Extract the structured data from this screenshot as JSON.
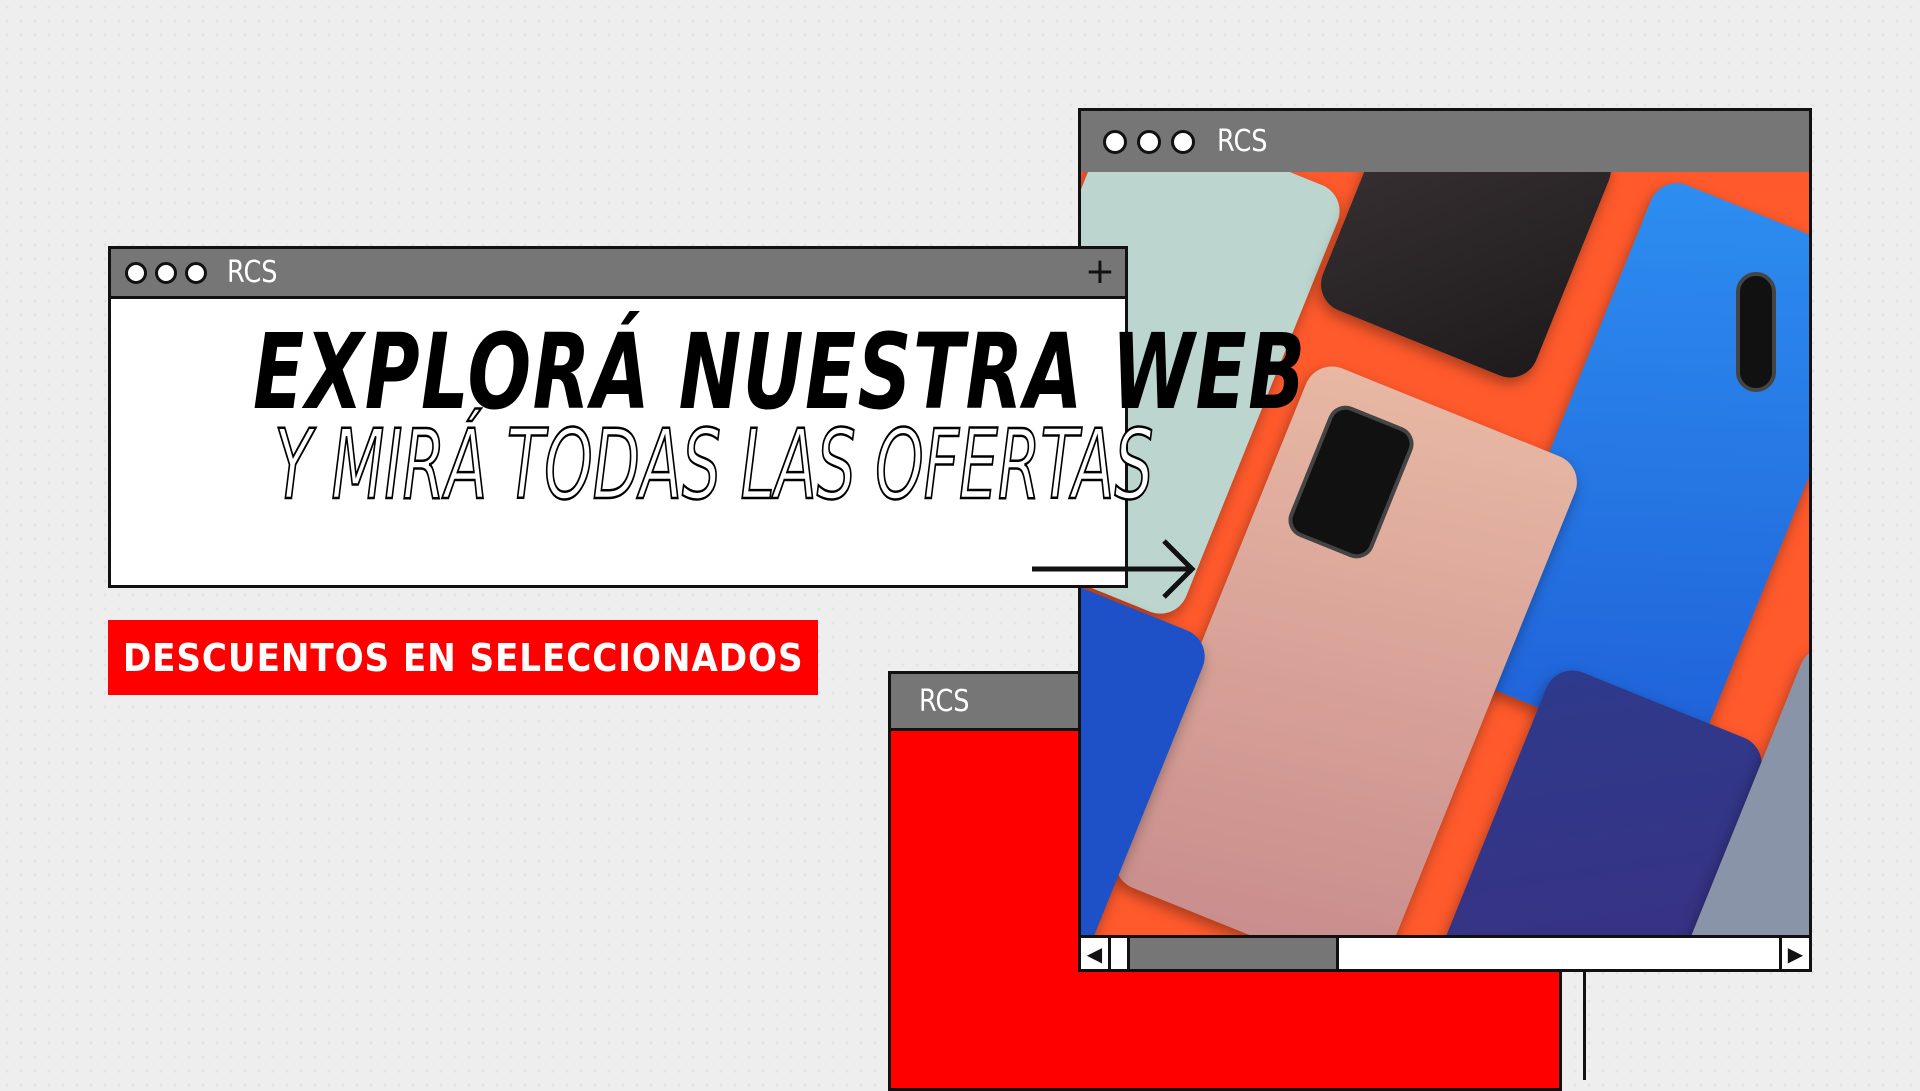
{
  "windows": {
    "main": {
      "title": "RCS",
      "plus": "+"
    },
    "photo": {
      "title": "RCS",
      "scroll_left": "◀",
      "scroll_right": "▶",
      "scroll_position": 0.2
    },
    "back": {
      "title": "RCS"
    }
  },
  "headline": {
    "line1": "EXPLORÁ NUESTRA WEB",
    "line2": "Y MIRÁ TODAS LAS OFERTAS"
  },
  "badge": "DESCUENTOS EN SELECCIONADOS",
  "colors": {
    "accent": "#ff0000",
    "titlebar": "#767676",
    "photo_bg": "#ff5a2c"
  }
}
